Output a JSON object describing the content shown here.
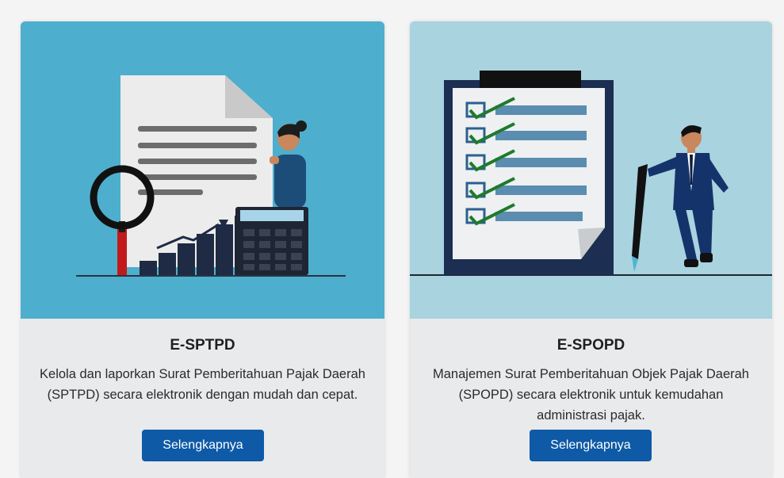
{
  "cards": [
    {
      "title": "E-SPTPD",
      "description": "Kelola dan laporkan Surat Pemberitahuan Pajak Daerah (SPTPD) secara elektronik dengan mudah dan cepat.",
      "button_label": "Selengkapnya",
      "image_bg": "#4eaecd",
      "illustration": "document-magnifier-chart-calculator-icon"
    },
    {
      "title": "E-SPOPD",
      "description": "Manajemen Surat Pemberitahuan Objek Pajak Daerah (SPOPD) secara elektronik untuk kemudahan administrasi pajak.",
      "button_label": "Selengkapnya",
      "image_bg": "#a9d3df",
      "illustration": "checklist-clipboard-businessman-pen-icon"
    }
  ],
  "colors": {
    "button": "#0e5aa7",
    "card_body": "#e9eaec",
    "page_bg": "#f4f4f4"
  }
}
